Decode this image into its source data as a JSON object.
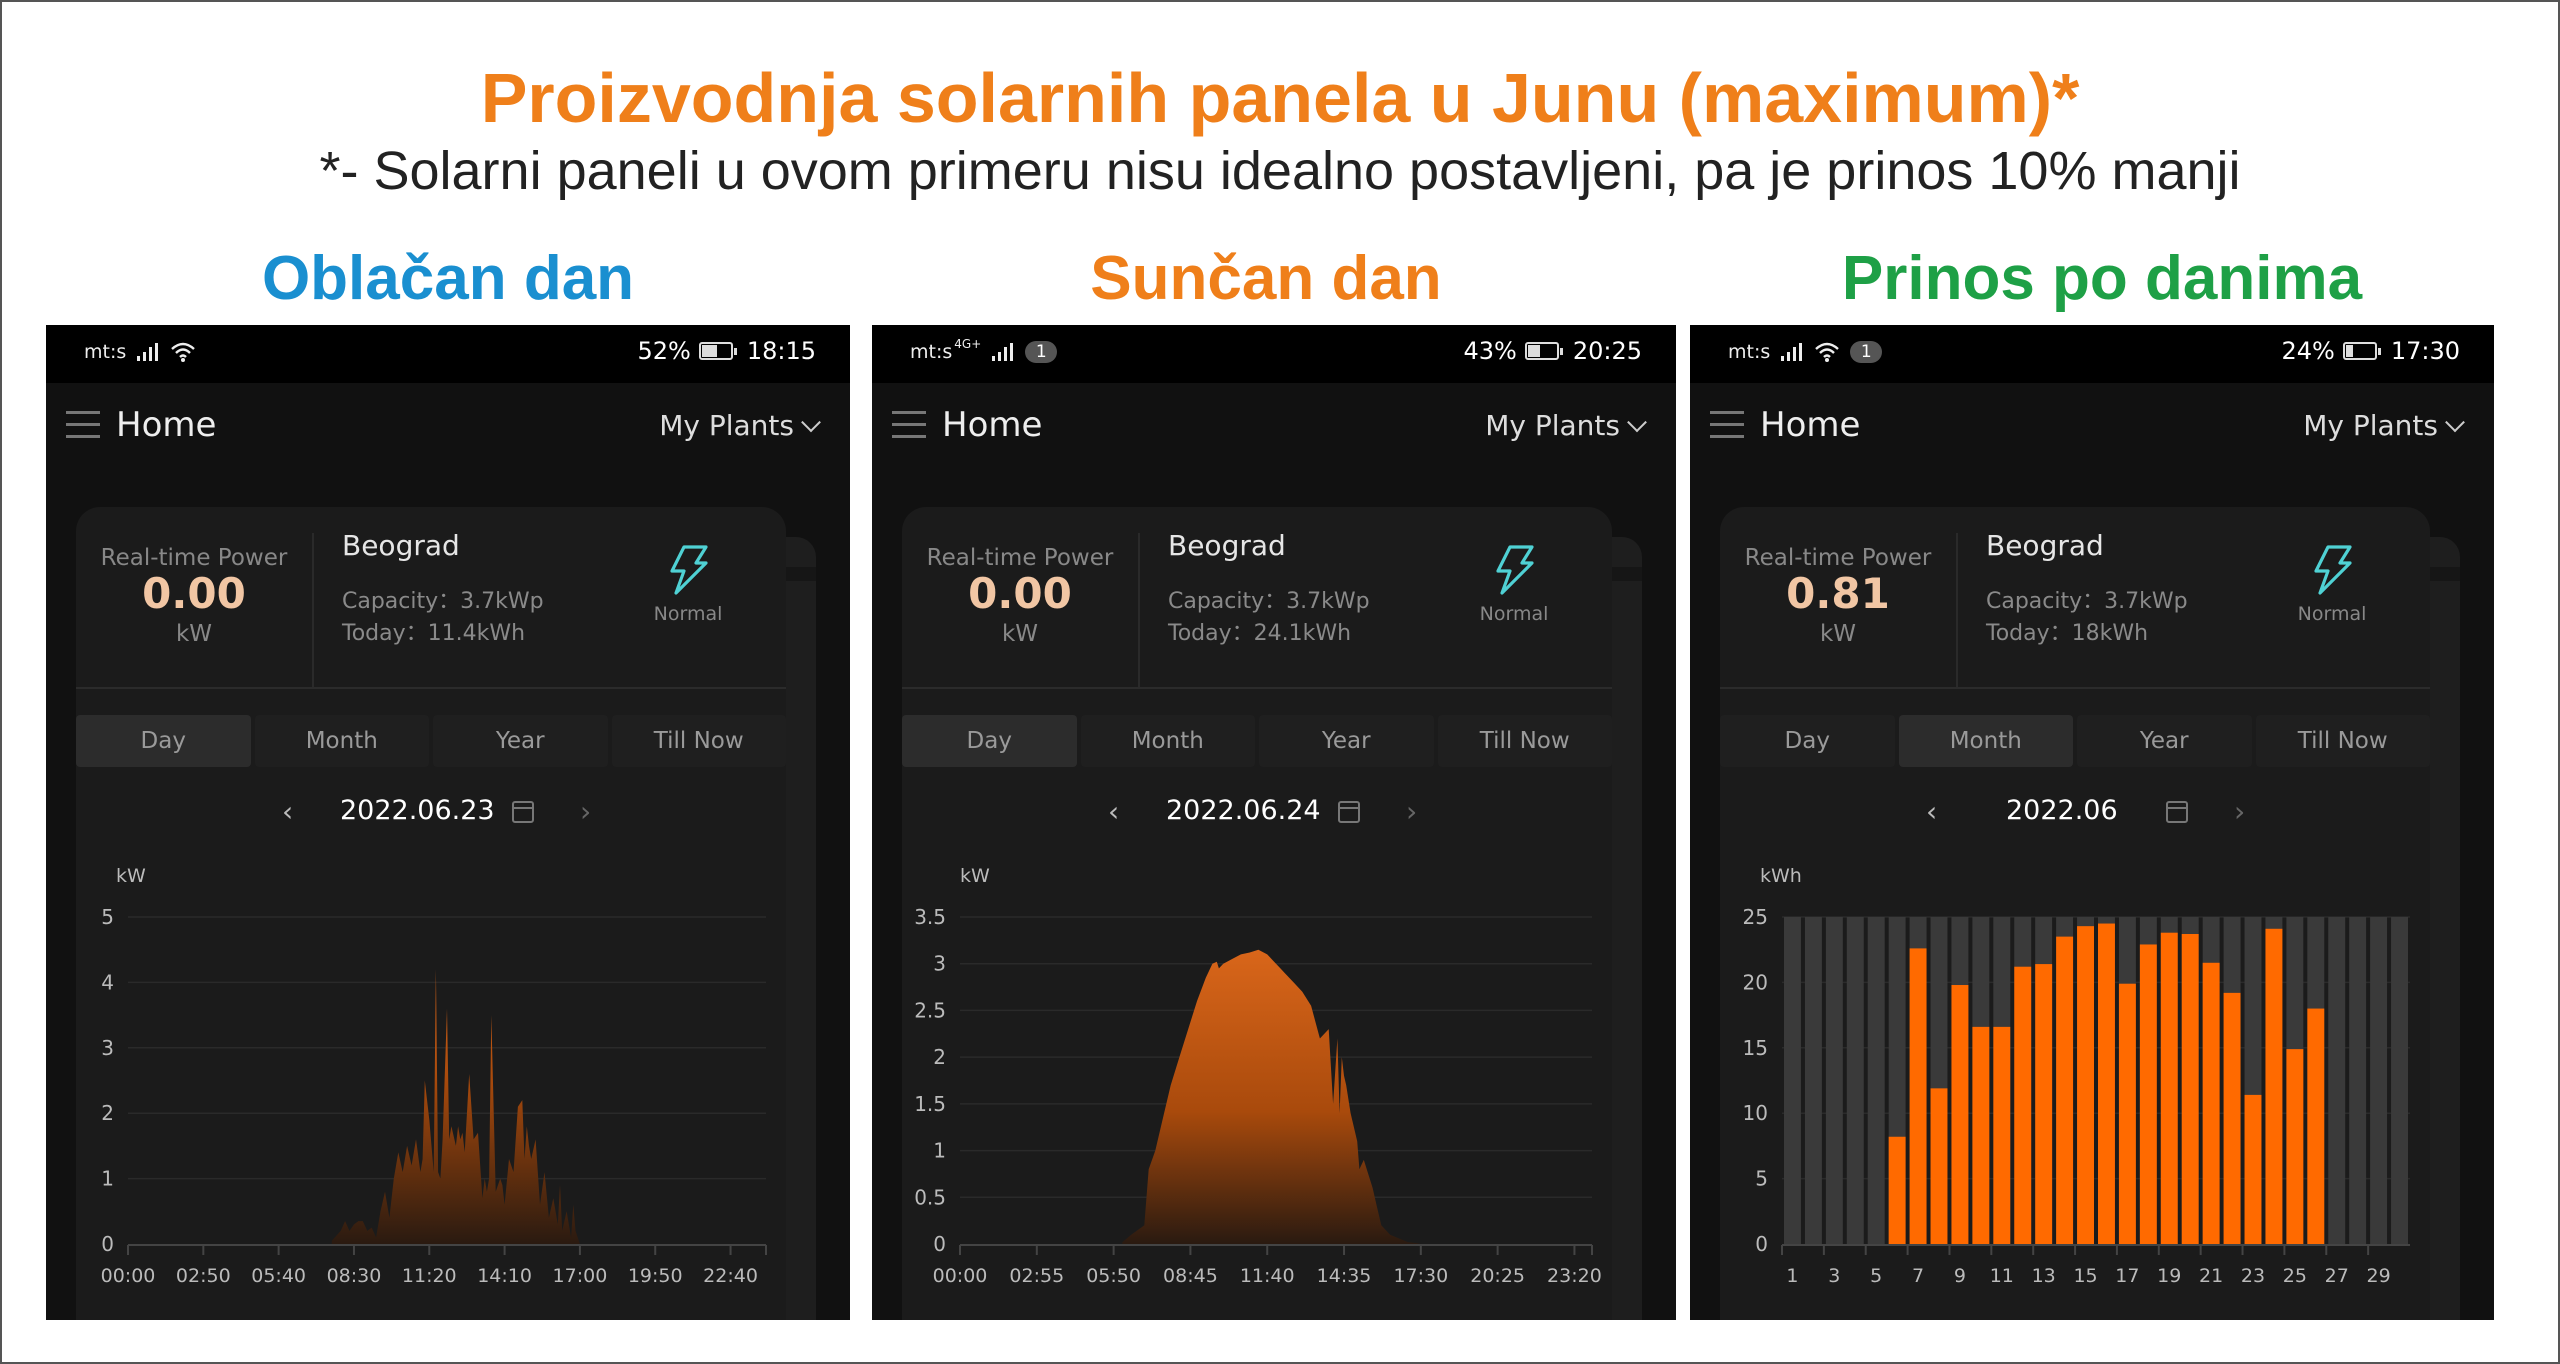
{
  "page": {
    "title": "Proizvodnja solarnih panela u Junu (maximum)*",
    "subtitle": "*- Solarni paneli u ovom primeru nisu idealno postavljeni, pa je prinos 10% manji",
    "colors": {
      "title": "#ef7f1a",
      "cloudy": "#1a8fd0",
      "sunny": "#ef7f1a",
      "yield": "#1ea046",
      "accent_bar": "#ff6a00",
      "status_icon": "#4fd1d4"
    }
  },
  "panels": [
    {
      "section_title": "Oblačan dan",
      "status_bar": {
        "carrier": "mt:s",
        "network": "",
        "notifications": "",
        "battery": "52%",
        "battery_level": 0.52,
        "time": "18:15",
        "icons": [
          "signal-icon",
          "wifi-icon"
        ]
      },
      "app_bar": {
        "menu_icon": "hamburger-icon",
        "title": "Home",
        "plants_selector": "My Plants"
      },
      "card": {
        "realtime_label": "Real-time Power",
        "realtime_value": "0.00",
        "realtime_unit": "kW",
        "plant_name": "Beograd",
        "capacity": "Capacity：3.7kWp",
        "today": "Today：11.4kWh",
        "status": "Normal",
        "status_icon": "lightning-icon"
      },
      "tabs": [
        {
          "label": "Day",
          "active": true
        },
        {
          "label": "Month",
          "active": false
        },
        {
          "label": "Year",
          "active": false
        },
        {
          "label": "Till Now",
          "active": false
        }
      ],
      "date_nav": {
        "date": "2022.06.23",
        "prev_icon": "chevron-left-icon",
        "next_icon": "chevron-right-icon",
        "calendar_icon": "calendar-icon"
      }
    },
    {
      "section_title": "Sunčan dan",
      "status_bar": {
        "carrier": "mt:s",
        "network": "4G+",
        "notifications": "1",
        "battery": "43%",
        "battery_level": 0.43,
        "time": "20:25",
        "icons": [
          "signal-icon"
        ]
      },
      "app_bar": {
        "menu_icon": "hamburger-icon",
        "title": "Home",
        "plants_selector": "My Plants"
      },
      "card": {
        "realtime_label": "Real-time Power",
        "realtime_value": "0.00",
        "realtime_unit": "kW",
        "plant_name": "Beograd",
        "capacity": "Capacity：3.7kWp",
        "today": "Today：24.1kWh",
        "status": "Normal",
        "status_icon": "lightning-icon"
      },
      "tabs": [
        {
          "label": "Day",
          "active": true
        },
        {
          "label": "Month",
          "active": false
        },
        {
          "label": "Year",
          "active": false
        },
        {
          "label": "Till Now",
          "active": false
        }
      ],
      "date_nav": {
        "date": "2022.06.24",
        "prev_icon": "chevron-left-icon",
        "next_icon": "chevron-right-icon",
        "calendar_icon": "calendar-icon"
      }
    },
    {
      "section_title": "Prinos po danima",
      "status_bar": {
        "carrier": "mt:s",
        "network": "",
        "notifications": "1",
        "battery": "24%",
        "battery_level": 0.24,
        "time": "17:30",
        "icons": [
          "signal-icon",
          "wifi-icon"
        ]
      },
      "app_bar": {
        "menu_icon": "hamburger-icon",
        "title": "Home",
        "plants_selector": "My Plants"
      },
      "card": {
        "realtime_label": "Real-time Power",
        "realtime_value": "0.81",
        "realtime_unit": "kW",
        "plant_name": "Beograd",
        "capacity": "Capacity：3.7kWp",
        "today": "Today：18kWh",
        "status": "Normal",
        "status_icon": "lightning-icon"
      },
      "tabs": [
        {
          "label": "Day",
          "active": false
        },
        {
          "label": "Month",
          "active": true
        },
        {
          "label": "Year",
          "active": false
        },
        {
          "label": "Till Now",
          "active": false
        }
      ],
      "date_nav": {
        "date": "2022.06",
        "prev_icon": "chevron-left-icon",
        "next_icon": "chevron-right-icon",
        "calendar_icon": "calendar-icon"
      }
    }
  ],
  "chart_data": [
    {
      "type": "area",
      "title": "Oblačan dan (2022.06.23)",
      "ylabel": "kW",
      "ylim": [
        0,
        5
      ],
      "yticks": [
        0,
        1,
        2,
        3,
        4,
        5
      ],
      "xlim_minutes": [
        0,
        1440
      ],
      "xtick_labels": [
        "00:00",
        "02:50",
        "05:40",
        "08:30",
        "11:20",
        "14:10",
        "17:00",
        "19:50",
        "22:40"
      ],
      "xtick_minutes": [
        0,
        170,
        340,
        510,
        680,
        850,
        1020,
        1190,
        1360
      ],
      "grid": true,
      "series": [
        {
          "name": "Power",
          "x_minutes": [
            460,
            480,
            490,
            500,
            510,
            520,
            530,
            540,
            550,
            560,
            570,
            580,
            590,
            600,
            610,
            620,
            630,
            640,
            650,
            660,
            665,
            670,
            680,
            690,
            695,
            700,
            705,
            710,
            720,
            725,
            730,
            740,
            745,
            750,
            755,
            760,
            770,
            780,
            790,
            800,
            805,
            810,
            815,
            820,
            830,
            840,
            845,
            850,
            860,
            870,
            880,
            890,
            895,
            900,
            905,
            910,
            920,
            930,
            940,
            950,
            960,
            970,
            975,
            980,
            990,
            1000,
            1005,
            1010,
            1015,
            1020,
            1030,
            1040,
            1045,
            1050,
            1060,
            1070,
            1080,
            1090
          ],
          "values": [
            0.05,
            0.2,
            0.35,
            0.2,
            0.3,
            0.35,
            0.35,
            0.2,
            0.25,
            0.1,
            0.5,
            0.8,
            0.4,
            1.0,
            1.4,
            1.1,
            1.5,
            1.2,
            1.6,
            1.1,
            1.3,
            2.5,
            1.9,
            1.1,
            4.2,
            1.1,
            1.0,
            1.6,
            3.6,
            1.6,
            1.8,
            1.5,
            1.8,
            1.6,
            1.7,
            1.4,
            2.6,
            1.6,
            1.7,
            0.7,
            1.0,
            0.8,
            1.0,
            3.5,
            0.8,
            1.0,
            0.9,
            0.6,
            1.3,
            1.1,
            2.1,
            2.2,
            1.3,
            1.8,
            1.5,
            1.3,
            1.6,
            0.6,
            1.1,
            0.4,
            0.7,
            0.3,
            0.9,
            0.2,
            0.5,
            0.1,
            0.6,
            0.2,
            0.1,
            0,
            0,
            0,
            0,
            0,
            0,
            0,
            0,
            0
          ]
        }
      ]
    },
    {
      "type": "area",
      "title": "Sunčan dan (2022.06.24)",
      "ylabel": "kW",
      "ylim": [
        0,
        3.5
      ],
      "yticks": [
        0,
        0.5,
        1,
        1.5,
        2,
        2.5,
        3,
        3.5
      ],
      "xlim_minutes": [
        0,
        1440
      ],
      "xtick_labels": [
        "00:00",
        "02:55",
        "05:50",
        "08:45",
        "11:40",
        "14:35",
        "17:30",
        "20:25",
        "23:20"
      ],
      "xtick_minutes": [
        0,
        175,
        350,
        525,
        700,
        875,
        1050,
        1225,
        1400
      ],
      "grid": true,
      "series": [
        {
          "name": "Power",
          "x_minutes": [
            370,
            390,
            420,
            430,
            445,
            460,
            480,
            500,
            520,
            540,
            560,
            575,
            585,
            590,
            600,
            620,
            640,
            660,
            680,
            700,
            720,
            730,
            740,
            760,
            780,
            800,
            820,
            840,
            850,
            860,
            865,
            870,
            875,
            880,
            890,
            900,
            905,
            910,
            920,
            930,
            940,
            950,
            960,
            980,
            1000,
            1020,
            1040,
            1050,
            1060,
            1080,
            1100
          ],
          "values": [
            0.02,
            0.1,
            0.2,
            0.8,
            1.0,
            1.3,
            1.7,
            2.0,
            2.3,
            2.6,
            2.85,
            3.0,
            3.02,
            2.95,
            3.0,
            3.05,
            3.1,
            3.12,
            3.15,
            3.1,
            3.0,
            2.95,
            2.9,
            2.8,
            2.7,
            2.55,
            2.2,
            2.3,
            1.5,
            2.2,
            1.4,
            2.0,
            1.8,
            1.7,
            1.4,
            1.2,
            1.1,
            0.8,
            0.9,
            0.75,
            0.6,
            0.4,
            0.2,
            0.1,
            0.06,
            0.02,
            0.01,
            0.0,
            0.0,
            0.0,
            0.0
          ]
        }
      ]
    },
    {
      "type": "bar",
      "title": "Prinos po danima (2022.06)",
      "ylabel": "kWh",
      "ylim": [
        0,
        25
      ],
      "yticks": [
        0,
        5,
        10,
        15,
        20,
        25
      ],
      "categories": [
        1,
        2,
        3,
        4,
        5,
        6,
        7,
        8,
        9,
        10,
        11,
        12,
        13,
        14,
        15,
        16,
        17,
        18,
        19,
        20,
        21,
        22,
        23,
        24,
        25,
        26,
        27,
        28,
        29,
        30
      ],
      "xtick_labels": [
        "1",
        "3",
        "5",
        "7",
        "9",
        "11",
        "13",
        "15",
        "17",
        "19",
        "21",
        "23",
        "25",
        "27",
        "29"
      ],
      "grid": true,
      "series": [
        {
          "name": "Daily yield",
          "values": [
            0,
            0,
            0,
            0,
            0,
            8.2,
            22.6,
            11.9,
            19.8,
            16.6,
            16.6,
            21.2,
            21.4,
            23.5,
            24.3,
            24.5,
            19.9,
            22.9,
            23.8,
            23.7,
            21.5,
            19.2,
            11.4,
            24.1,
            14.9,
            18.0,
            0,
            0,
            0,
            0
          ]
        }
      ]
    }
  ]
}
